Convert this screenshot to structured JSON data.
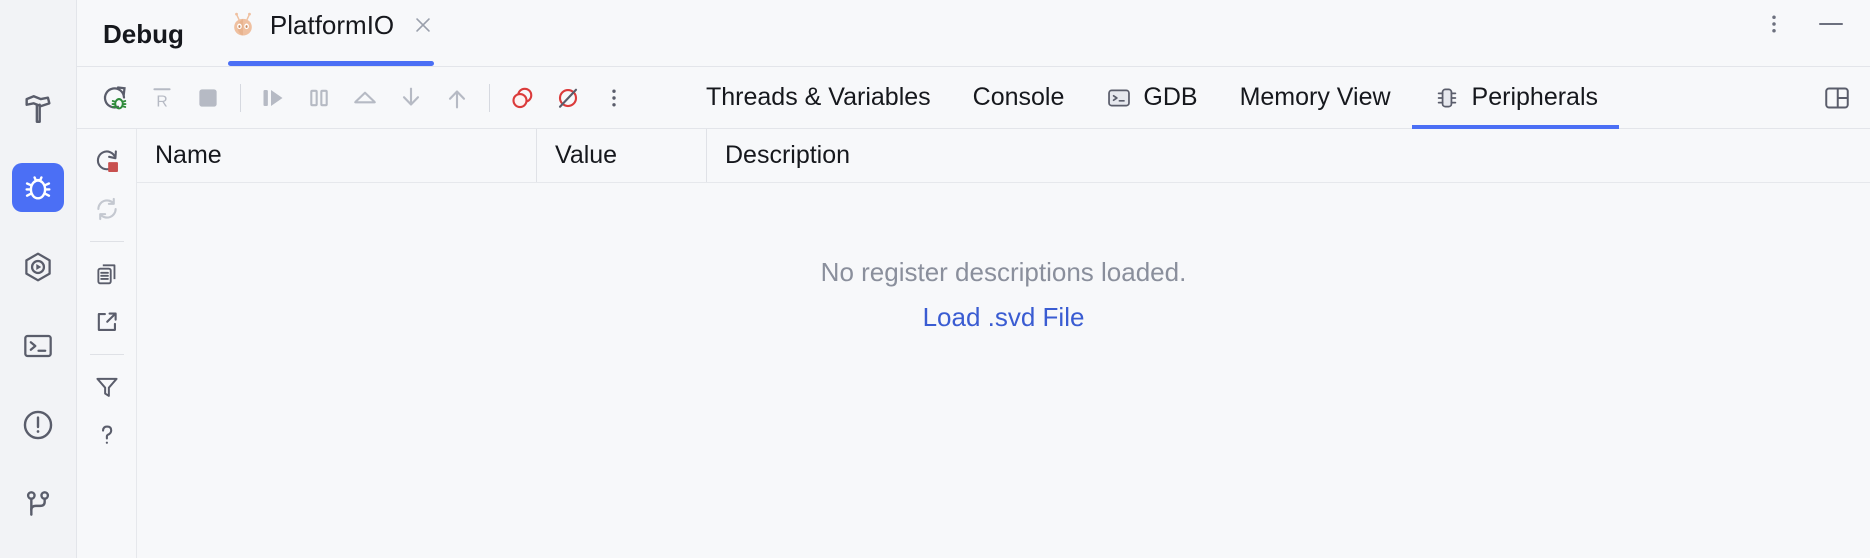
{
  "window": {
    "title": "Debug",
    "tab": {
      "label": "PlatformIO",
      "icon": "platformio-alien-icon",
      "close_icon": "close-icon"
    },
    "controls": [
      {
        "name": "more-options-button",
        "icon": "kebab-menu-icon",
        "label": "⋮"
      },
      {
        "name": "minimize-button",
        "icon": "minimize-icon",
        "label": "—"
      }
    ],
    "accent_color": "#4B6FF5",
    "background": "#F7F8FA"
  },
  "activity_bar": {
    "items": [
      {
        "name": "sidebar-item-build",
        "icon": "hammer-icon",
        "selected": false
      },
      {
        "name": "sidebar-item-debug",
        "icon": "bug-icon",
        "selected": true
      },
      {
        "name": "sidebar-item-run",
        "icon": "run-hex-icon",
        "selected": false
      },
      {
        "name": "sidebar-item-terminal",
        "icon": "terminal-icon",
        "selected": false
      },
      {
        "name": "sidebar-item-problems",
        "icon": "warning-circle-icon",
        "selected": false
      },
      {
        "name": "sidebar-item-vcs",
        "icon": "git-branch-icon",
        "selected": false
      }
    ]
  },
  "debug_toolbar": {
    "buttons": [
      {
        "name": "rerun-debug-button",
        "icon": "rerun-debug-icon",
        "enabled": true
      },
      {
        "name": "restart-button",
        "icon": "restart-r-icon",
        "enabled": false
      },
      {
        "name": "stop-button",
        "icon": "stop-square-icon",
        "enabled": false
      },
      {
        "name": "resume-button",
        "icon": "resume-program-icon",
        "enabled": false
      },
      {
        "name": "pause-button",
        "icon": "pause-program-icon",
        "enabled": false
      },
      {
        "name": "step-over-button",
        "icon": "step-over-icon",
        "enabled": false
      },
      {
        "name": "step-into-button",
        "icon": "step-into-icon",
        "enabled": false
      },
      {
        "name": "step-out-button",
        "icon": "step-out-icon",
        "enabled": false
      },
      {
        "name": "view-breakpoints-button",
        "icon": "breakpoints-icon",
        "enabled": true
      },
      {
        "name": "mute-breakpoints-button",
        "icon": "mute-breakpoints-icon",
        "enabled": true
      },
      {
        "name": "toolbar-more-button",
        "icon": "kebab-menu-icon",
        "enabled": true
      }
    ]
  },
  "view_tabs": [
    {
      "name": "tab-threads-and-variables",
      "label": "Threads & Variables",
      "icon": null,
      "active": false
    },
    {
      "name": "tab-console",
      "label": "Console",
      "icon": null,
      "active": false
    },
    {
      "name": "tab-gdb",
      "label": "GDB",
      "icon": "terminal-small-icon",
      "active": false
    },
    {
      "name": "tab-memory-view",
      "label": "Memory View",
      "icon": null,
      "active": false
    },
    {
      "name": "tab-peripherals",
      "label": "Peripherals",
      "icon": "chip-icon",
      "active": true
    }
  ],
  "split_button": {
    "name": "split-layout-button",
    "icon": "split-panel-icon"
  },
  "side_strip": {
    "buttons": [
      {
        "name": "reload-on-stop-button",
        "icon": "refresh-stop-icon",
        "enabled": true
      },
      {
        "name": "refresh-button",
        "icon": "refresh-icon",
        "enabled": false
      },
      {
        "name": "copy-button",
        "icon": "copy-icon",
        "enabled": true
      },
      {
        "name": "export-button",
        "icon": "export-arrow-icon",
        "enabled": true
      },
      {
        "name": "filter-button",
        "icon": "filter-funnel-icon",
        "enabled": true
      },
      {
        "name": "help-button",
        "icon": "question-mark-icon",
        "enabled": true
      }
    ]
  },
  "peripherals_table": {
    "columns": [
      {
        "name": "column-header-name",
        "label": "Name"
      },
      {
        "name": "column-header-value",
        "label": "Value"
      },
      {
        "name": "column-header-description",
        "label": "Description"
      }
    ],
    "rows": [],
    "empty_state": {
      "message": "No register descriptions loaded.",
      "link_label": "Load .svd File",
      "link_color": "#3A5CD2",
      "message_color": "#8A8F9C"
    }
  }
}
